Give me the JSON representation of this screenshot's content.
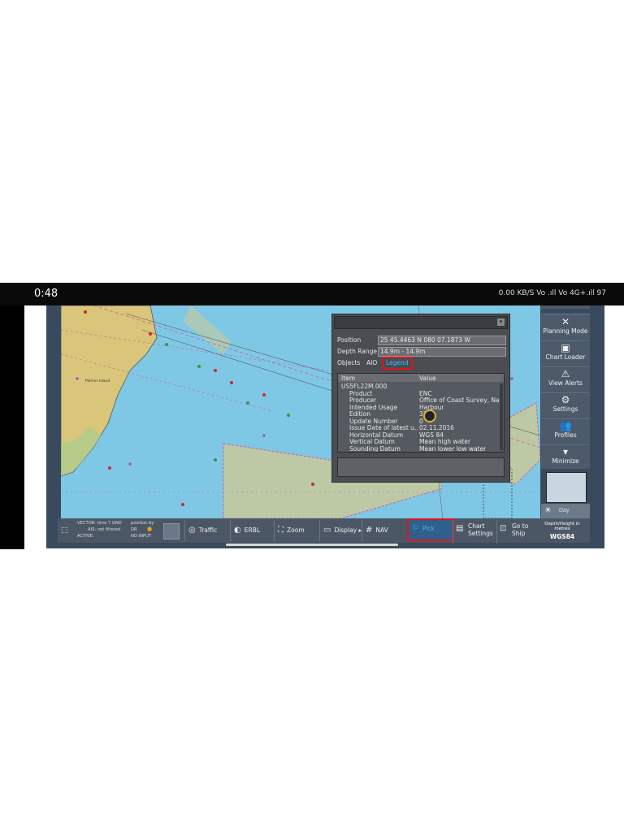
{
  "status": {
    "time": "0:48",
    "icons_text": "0.00 KB/S  Vo  .ıll  Vo  4G+.ıll  97",
    "battery": "97"
  },
  "map": {
    "label_island": "Palmer Island"
  },
  "pick_panel": {
    "position_label": "Position",
    "position_value": "25 45.4463 N  080 07.1873 W",
    "depth_label": "Depth Range",
    "depth_value": "14.9m - 14.9m",
    "tabs": [
      "Objects",
      "AIO",
      "Legend"
    ],
    "active_tab": "Legend",
    "columns": [
      "Item",
      "Value"
    ],
    "rows": [
      {
        "item": "US5FL22M.000",
        "value": ""
      },
      {
        "item": "Product",
        "value": "ENC"
      },
      {
        "item": "Producer",
        "value": "Office of Coast Survey, Na..."
      },
      {
        "item": "Intended Usage",
        "value": "Harbour"
      },
      {
        "item": "Edition",
        "value": "37"
      },
      {
        "item": "Update Number",
        "value": "0"
      },
      {
        "item": "Issue Date of latest u...",
        "value": "02.11.2016"
      },
      {
        "item": "Horizontal Datum",
        "value": "WGS 84"
      },
      {
        "item": "Vertical Datum",
        "value": "Mean high water"
      },
      {
        "item": "Sounding Datum",
        "value": "Mean lower low water"
      }
    ]
  },
  "right_menu": {
    "items": [
      {
        "label": "Planning Mode",
        "icon": "tools-icon"
      },
      {
        "label": "Chart Loader",
        "icon": "chart-loader-icon"
      },
      {
        "label": "View Alerts",
        "icon": "alert-icon"
      },
      {
        "label": "Settings",
        "icon": "gear-icon"
      },
      {
        "label": "Profiles",
        "icon": "profiles-icon"
      },
      {
        "label": "Minimize",
        "icon": "chevron-down-icon"
      }
    ],
    "day_label": "Day"
  },
  "bottom_bar": {
    "info": {
      "vector": "VECTOR: time 7 GND",
      "ais": "AIS: not filtered",
      "active": "ACTIVE:",
      "position_by": "position by",
      "dr": "DR",
      "no_input": "NO INPUT"
    },
    "buttons": [
      "Traffic",
      "ERBL",
      "Zoom",
      "Display",
      "NAV",
      "Pick",
      "Chart Settings",
      "Go to Ship"
    ],
    "active_button": "Pick",
    "depth_height_label": "Depth/Height in metres",
    "datum": "WGS84"
  },
  "colors": {
    "water": "#7ec8e6",
    "land": "#d9c67a",
    "panel": "#4a4d52",
    "highlight": "#e0141e",
    "accent": "#36c0ff"
  }
}
